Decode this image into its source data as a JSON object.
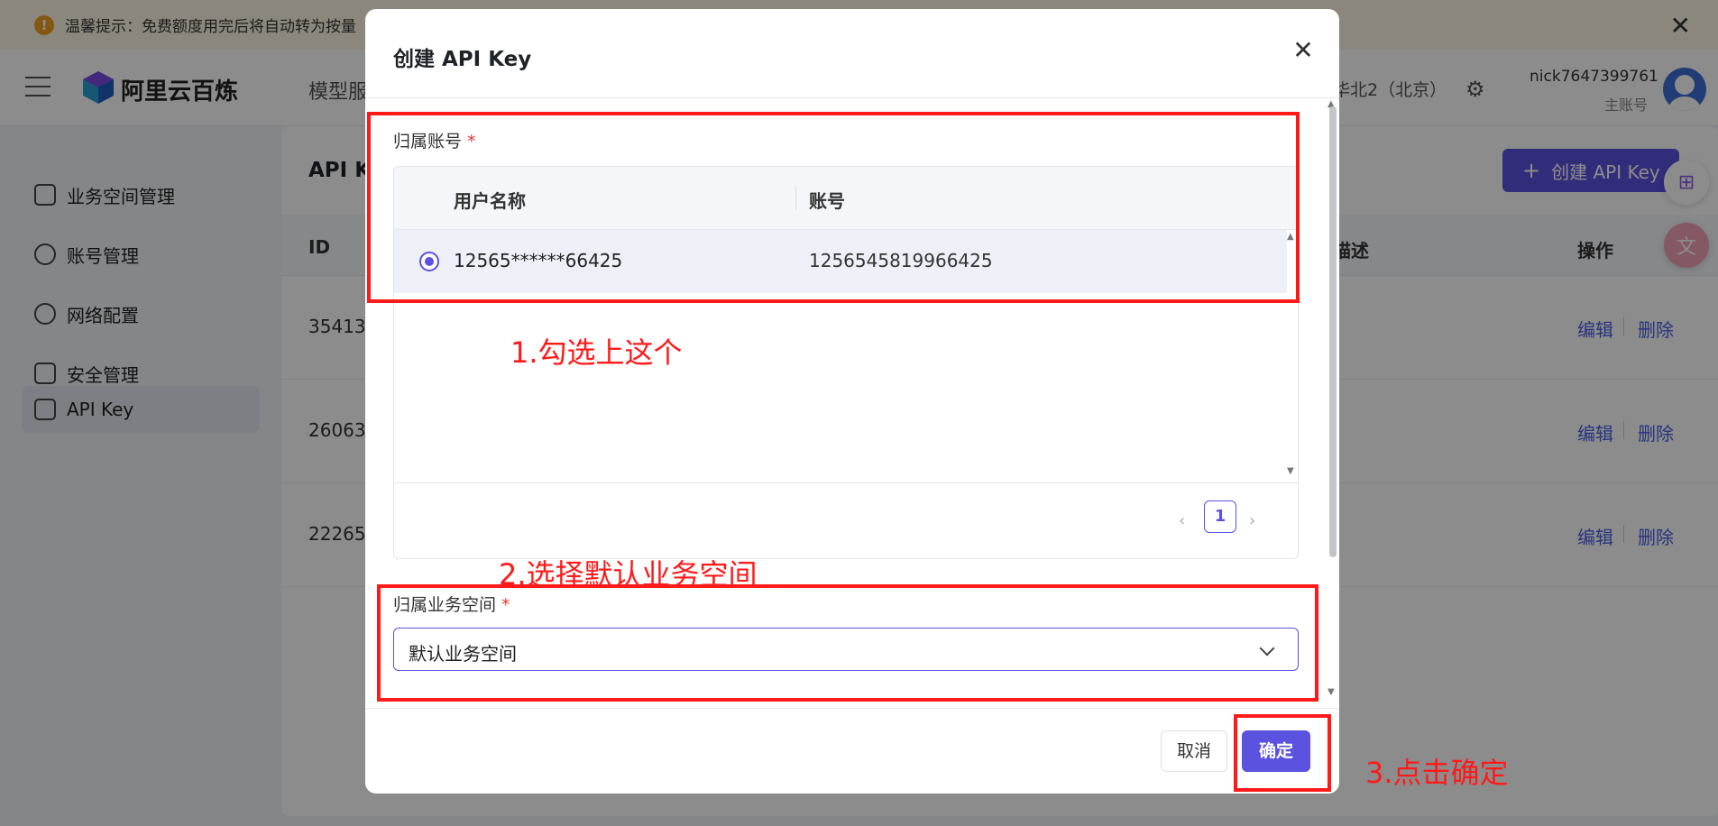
{
  "notice": {
    "text": "温馨提示：免费额度用完后将自动转为按量"
  },
  "header": {
    "logo_text": "阿里云百炼",
    "nav_partial": "模型服",
    "region": "华北2（北京）",
    "user_name": "nick7647399761",
    "user_role": "主账号"
  },
  "sidebar": {
    "items": [
      {
        "label": "业务空间管理"
      },
      {
        "label": "账号管理"
      },
      {
        "label": "网络配置"
      },
      {
        "label": "安全管理"
      },
      {
        "label": "API Key"
      }
    ]
  },
  "main": {
    "title_partial": "API Ke",
    "create_button": "创建 API Key",
    "columns": {
      "id": "ID",
      "desc": "描述",
      "ops": "操作"
    },
    "rows": [
      {
        "id": "35413",
        "edit": "编辑",
        "delete": "删除"
      },
      {
        "id": "26063",
        "edit": "编辑",
        "delete": "删除"
      },
      {
        "id": "22265",
        "edit": "编辑",
        "delete": "删除"
      }
    ]
  },
  "modal": {
    "title": "创建 API Key",
    "account_label": "归属账号",
    "required_mark": "*",
    "table": {
      "col_user": "用户名称",
      "col_account": "账号",
      "rows": [
        {
          "user": "12565******66425",
          "account": "1256545819966425",
          "selected": true
        }
      ]
    },
    "pagination": {
      "current_page": "1"
    },
    "workspace_label": "归属业务空间",
    "workspace_value": "默认业务空间",
    "cancel": "取消",
    "confirm": "确定"
  },
  "annotations": {
    "step1": "1.勾选上这个",
    "step2": "2.选择默认业务空间",
    "step3": "3.点击确定",
    "color": "#ff1a1a"
  },
  "colors": {
    "accent": "#5b52e0",
    "link": "#4a5fe6",
    "required": "#e23b3b"
  }
}
